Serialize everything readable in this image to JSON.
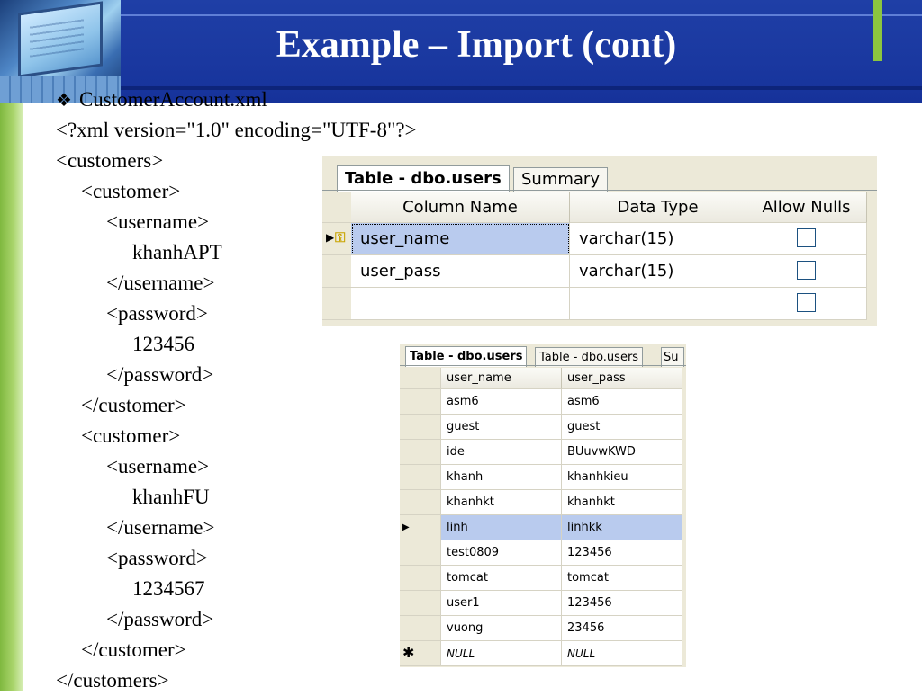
{
  "slide": {
    "title": "Example – Import (cont)"
  },
  "xml": {
    "file_name": "CustomerAccount.xml",
    "lines": [
      "<?xml version=\"1.0\" encoding=\"UTF-8\"?>",
      "<customers>",
      "<customer>",
      "<username>",
      "khanhAPT",
      "</username>",
      "<password>",
      "123456",
      "</password>",
      "</customer>",
      "<customer>",
      "<username>",
      "khanhFU",
      "</username>",
      "<password>",
      "1234567",
      "</password>",
      "</customer>",
      "</customers>"
    ]
  },
  "designer": {
    "tabs": [
      "Table - dbo.users",
      "Summary"
    ],
    "columns": [
      "Column Name",
      "Data Type",
      "Allow Nulls"
    ],
    "rows": [
      {
        "name": "user_name",
        "type": "varchar(15)"
      },
      {
        "name": "user_pass",
        "type": "varchar(15)"
      },
      {
        "name": "",
        "type": ""
      }
    ]
  },
  "grid": {
    "tabs": [
      "Table - dbo.users",
      "Table - dbo.users",
      "Su"
    ],
    "columns": [
      "user_name",
      "user_pass"
    ],
    "rows": [
      [
        "asm6",
        "asm6"
      ],
      [
        "guest",
        "guest"
      ],
      [
        "ide",
        "BUuvwKWD"
      ],
      [
        "khanh",
        "khanhkieu"
      ],
      [
        "khanhkt",
        "khanhkt"
      ],
      [
        "linh",
        "linhkk"
      ],
      [
        "test0809",
        "123456"
      ],
      [
        "tomcat",
        "tomcat"
      ],
      [
        "user1",
        "123456"
      ],
      [
        "vuong",
        "23456"
      ]
    ],
    "new_row": [
      "NULL",
      "NULL"
    ]
  },
  "colors": {
    "title_band": "#1f3fa6",
    "accent_green": "#8cc63f",
    "selection": "#b9cbee"
  }
}
